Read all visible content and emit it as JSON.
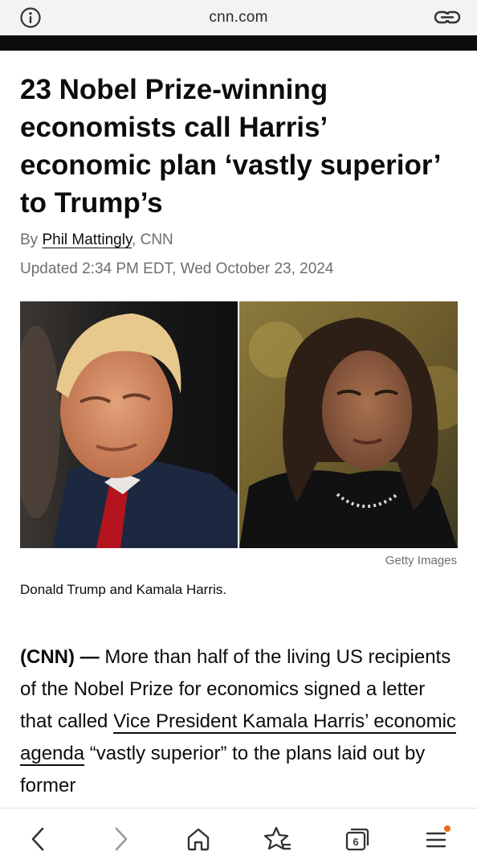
{
  "browser": {
    "url": "cnn.com",
    "tab_count": "6",
    "accent_dot_color": "#f06a1a"
  },
  "article": {
    "headline": "23 Nobel Prize-winning economists call Harris’ economic plan ‘vastly superior’ to Trump’s",
    "byline_prefix": "By ",
    "author": "Phil Mattingly",
    "byline_suffix": ", CNN",
    "updated": "Updated 2:34 PM EDT, Wed October 23, 2024",
    "image_credit": "Getty Images",
    "image_caption": "Donald Trump and Kamala Harris.",
    "body": {
      "dateline": "(CNN) —",
      "text_1": " More than half of the living US recipients of the Nobel Prize for economics signed a letter that called ",
      "link_text": "Vice President Kamala Harris’ economic agenda",
      "text_2": " “vastly superior” to the plans laid out by former"
    }
  },
  "icons": {
    "info": "info-icon",
    "link": "link-icon",
    "back": "chevron-left-icon",
    "forward": "chevron-right-icon",
    "home": "home-icon",
    "bookmark": "star-bookmark-icon",
    "tabs": "tabs-icon",
    "menu": "hamburger-menu-icon"
  }
}
